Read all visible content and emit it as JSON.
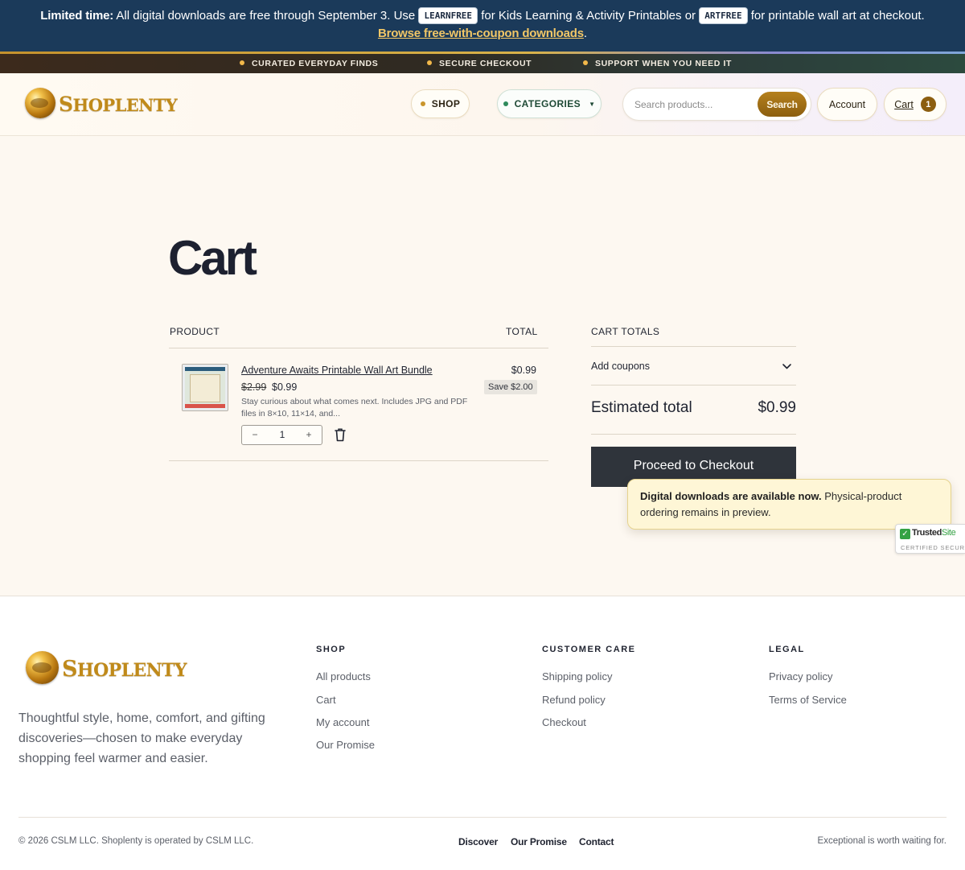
{
  "promo": {
    "lead": "Limited time:",
    "text1": "All digital downloads are free through September 3. Use",
    "code1": "LEARNFREE",
    "text2": "for Kids Learning & Activity Printables or",
    "code2": "ARTFREE",
    "text3": "for printable wall art at checkout.",
    "link": "Browse free-with-coupon downloads"
  },
  "strip": {
    "items": [
      "CURATED EVERYDAY FINDS",
      "SECURE CHECKOUT",
      "SUPPORT WHEN YOU NEED IT"
    ]
  },
  "header": {
    "logo_initial": "S",
    "logo_rest": "HOPLENTY",
    "shop_label": "SHOP",
    "categories_label": "CATEGORIES",
    "search_placeholder": "Search products...",
    "search_button": "Search",
    "account_label": "Account",
    "cart_label": "Cart",
    "cart_count": "1"
  },
  "cart": {
    "title": "Cart",
    "col_product": "PRODUCT",
    "col_total": "TOTAL",
    "item": {
      "name": "Adventure Awaits Printable Wall Art Bundle",
      "old_price": "$2.99",
      "price": "$0.99",
      "description": "Stay curious about what comes next. Includes JPG and PDF files in 8×10, 11×14, and...",
      "quantity": "1",
      "minus": "−",
      "plus": "+",
      "line_total": "$0.99",
      "save_badge": "Save $2.00"
    },
    "totals": {
      "title": "CART TOTALS",
      "coupons": "Add coupons",
      "estimated_label": "Estimated total",
      "estimated_value": "$0.99",
      "checkout_button": "Proceed to Checkout"
    },
    "notice": {
      "bold": "Digital downloads are available now.",
      "text": "Physical-product ordering remains in preview."
    }
  },
  "trusted_site": {
    "name_part1": "Trusted",
    "name_part2": "Site",
    "sub": "CERTIFIED SECURE",
    "check": "✓"
  },
  "footer": {
    "logo_initial": "S",
    "logo_rest": "HOPLENTY",
    "tagline": "Thoughtful style, home, comfort, and gifting discoveries—chosen to make everyday shopping feel warmer and easier.",
    "shop": {
      "title": "SHOP",
      "links": [
        "All products",
        "Cart",
        "My account",
        "Our Promise"
      ]
    },
    "customer_care": {
      "title": "CUSTOMER CARE",
      "links": [
        "Shipping policy",
        "Refund policy",
        "Checkout"
      ]
    },
    "legal": {
      "title": "LEGAL",
      "links": [
        "Privacy policy",
        "Terms of Service"
      ]
    },
    "copyright": "© 2026 CSLM LLC. Shoplenty is operated by CSLM LLC.",
    "bottom_links": [
      "Discover",
      "Our Promise",
      "Contact"
    ],
    "motto": "Exceptional is worth waiting for."
  },
  "colors": {
    "promo_bg": "#1b3a5a",
    "brand_gold": "#c08a1a",
    "checkout_bg": "#2f343b",
    "notice_bg": "#fef6d6"
  }
}
